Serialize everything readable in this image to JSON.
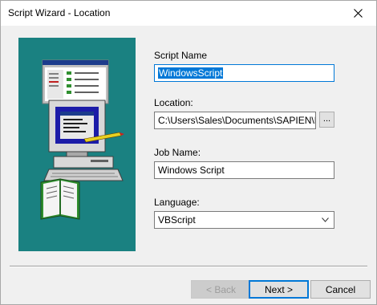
{
  "window": {
    "title": "Script Wizard - Location",
    "close_glyph": "×"
  },
  "form": {
    "script_name": {
      "label": "Script Name",
      "value": "WindowsScript"
    },
    "location": {
      "label": "Location:",
      "value": "C:\\Users\\Sales\\Documents\\SAPIEN\\Prima",
      "browse_label": "..."
    },
    "job_name": {
      "label": "Job Name:",
      "value": "Windows Script"
    },
    "language": {
      "label": "Language:",
      "value": "VBScript"
    }
  },
  "buttons": {
    "back": "< Back",
    "next": "Next >",
    "cancel": "Cancel"
  },
  "colors": {
    "illustration_bg": "#1a8181",
    "accent": "#0078d7"
  },
  "icons": {
    "close": "close-icon",
    "dropdown": "chevron-down-icon",
    "illustration": "computer-with-book-illustration"
  }
}
